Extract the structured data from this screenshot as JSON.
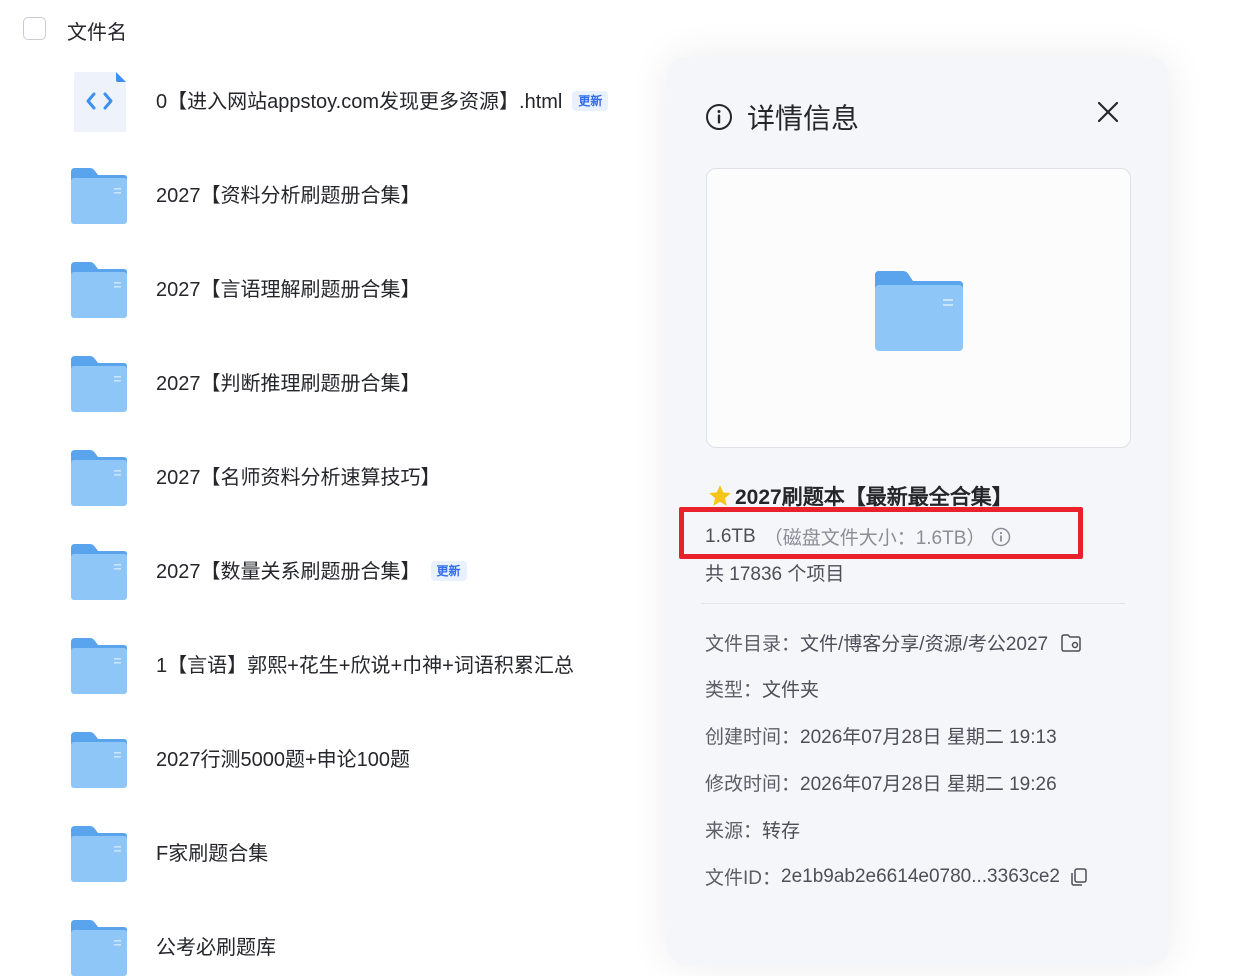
{
  "list": {
    "header_label": "文件名",
    "items": [
      {
        "name": "0【进入网站appstoy.com发现更多资源】.html",
        "type": "html",
        "badge": "更新"
      },
      {
        "name": "2027【资料分析刷题册合集】",
        "type": "folder",
        "badge": ""
      },
      {
        "name": "2027【言语理解刷题册合集】",
        "type": "folder",
        "badge": ""
      },
      {
        "name": "2027【判断推理刷题册合集】",
        "type": "folder",
        "badge": ""
      },
      {
        "name": "2027【名师资料分析速算技巧】",
        "type": "folder",
        "badge": ""
      },
      {
        "name": "2027【数量关系刷题册合集】",
        "type": "folder",
        "badge": "更新"
      },
      {
        "name": "1【言语】郭熙+花生+欣说+巾神+词语积累汇总",
        "type": "folder",
        "badge": ""
      },
      {
        "name": "2027行测5000题+申论100题",
        "type": "folder",
        "badge": ""
      },
      {
        "name": "F家刷题合集",
        "type": "folder",
        "badge": ""
      },
      {
        "name": "公考必刷题库",
        "type": "folder",
        "badge": ""
      }
    ]
  },
  "panel": {
    "title": "详情信息",
    "item_title": "2027刷题本【最新最全合集】",
    "size": "1.6TB",
    "disk_size": "（磁盘文件大小：1.6TB）",
    "count": "共 17836 个项目",
    "directory_label": "文件目录：",
    "directory": "文件/博客分享/资源/考公2027",
    "type_label": "类型：",
    "type": "文件夹",
    "created_label": "创建时间：",
    "created": "2026年07月28日 星期二 19:13",
    "modified_label": "修改时间：",
    "modified": "2026年07月28日 星期二 19:26",
    "source_label": "来源：",
    "source": "转存",
    "file_id_label": "文件ID：",
    "file_id": "2e1b9ab2e6614e0780...3363ce2"
  },
  "colors": {
    "folder": "#7fbcf5",
    "folder_tab": "#5aa4ee",
    "highlight": "#e8212b",
    "badge_text": "#2f6fe8",
    "star": "#f5c518"
  },
  "icons": {
    "info": "info-circle-icon",
    "close": "close-icon",
    "folder": "folder-icon",
    "star": "star-icon",
    "copy": "copy-icon",
    "folder_link": "folder-location-icon"
  }
}
